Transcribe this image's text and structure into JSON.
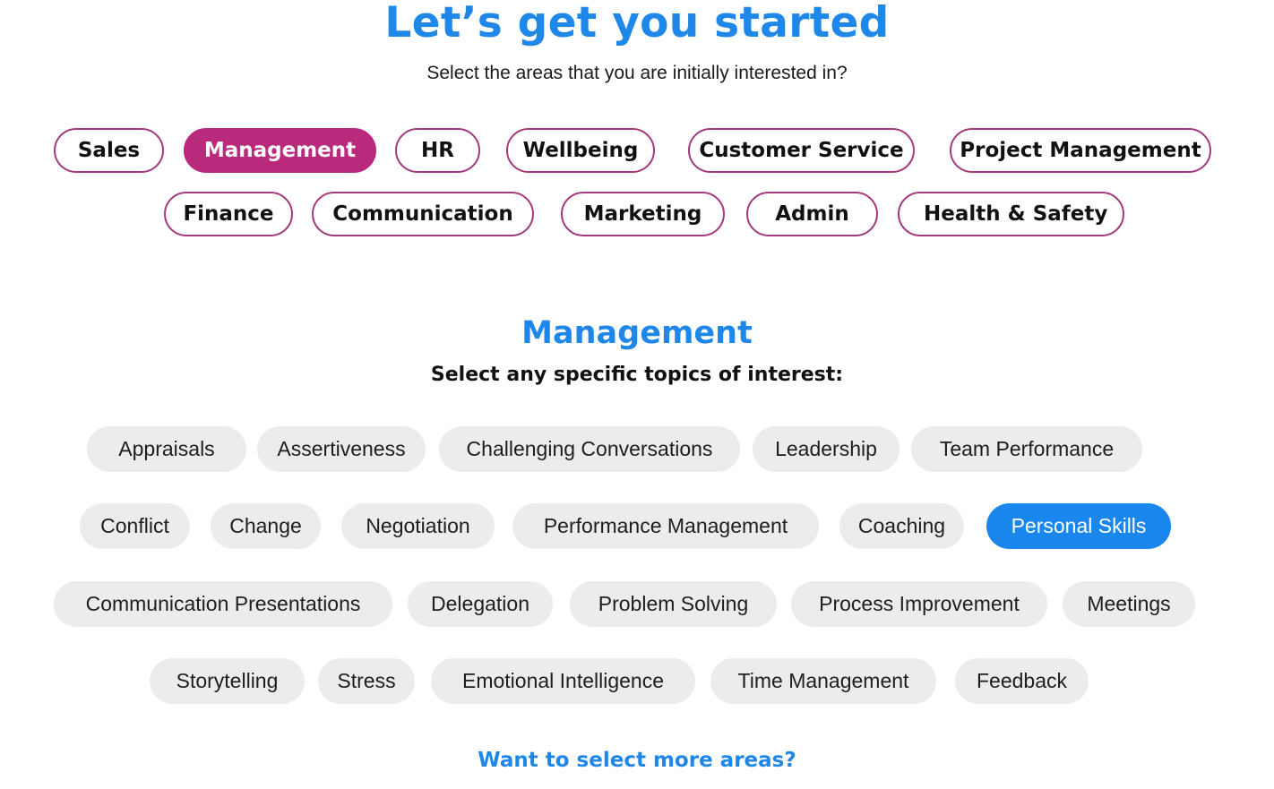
{
  "header": {
    "title": "Let’s get you started",
    "subtitle": "Select the areas that you are initially interested in?"
  },
  "areas": [
    {
      "label": "Sales",
      "selected": false
    },
    {
      "label": "Management",
      "selected": true
    },
    {
      "label": "HR",
      "selected": false
    },
    {
      "label": "Wellbeing",
      "selected": false
    },
    {
      "label": "Customer Service",
      "selected": false
    },
    {
      "label": "Project Management",
      "selected": false
    },
    {
      "label": "Finance",
      "selected": false
    },
    {
      "label": "Communication",
      "selected": false
    },
    {
      "label": "Marketing",
      "selected": false
    },
    {
      "label": "Admin",
      "selected": false
    },
    {
      "label": "Health & Safety",
      "selected": false
    }
  ],
  "section": {
    "title": "Management",
    "subtitle": "Select any specific topics of interest:"
  },
  "topics": [
    {
      "label": "Appraisals",
      "selected": false
    },
    {
      "label": "Assertiveness",
      "selected": false
    },
    {
      "label": "Challenging Conversations",
      "selected": false
    },
    {
      "label": "Leadership",
      "selected": false
    },
    {
      "label": "Team Performance",
      "selected": false
    },
    {
      "label": "Conflict",
      "selected": false
    },
    {
      "label": "Change",
      "selected": false
    },
    {
      "label": "Negotiation",
      "selected": false
    },
    {
      "label": "Performance Management",
      "selected": false
    },
    {
      "label": "Coaching",
      "selected": false
    },
    {
      "label": "Personal Skills",
      "selected": true
    },
    {
      "label": "Communication Presentations",
      "selected": false
    },
    {
      "label": "Delegation",
      "selected": false
    },
    {
      "label": "Problem Solving",
      "selected": false
    },
    {
      "label": "Process Improvement",
      "selected": false
    },
    {
      "label": "Meetings",
      "selected": false
    },
    {
      "label": "Storytelling",
      "selected": false
    },
    {
      "label": "Stress",
      "selected": false
    },
    {
      "label": "Emotional Intelligence",
      "selected": false
    },
    {
      "label": "Time Management",
      "selected": false
    },
    {
      "label": "Feedback",
      "selected": false
    }
  ],
  "footer": {
    "more_areas_link": "Want to select more areas?"
  },
  "colors": {
    "accent_blue": "#1f87e8",
    "area_selected": "#b9297c",
    "area_border": "#a33a7e",
    "topic_selected": "#1a87ef",
    "topic_bg": "#ececec"
  }
}
